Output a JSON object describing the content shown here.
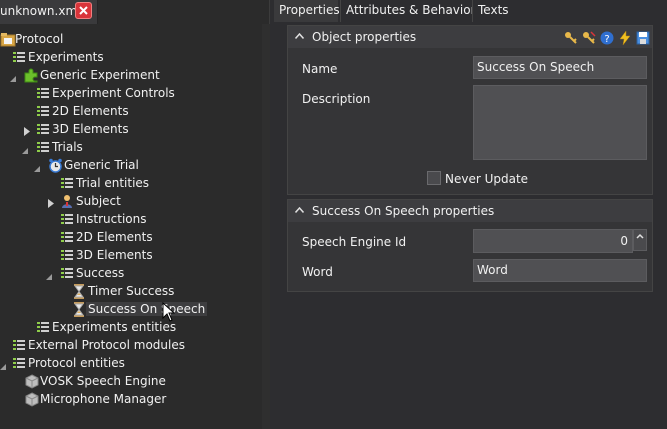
{
  "file_tab": {
    "label": "unknown.xml"
  },
  "tree": {
    "protocol": "Protocol",
    "experiments": "Experiments",
    "generic_experiment": "Generic Experiment",
    "experiment_controls": "Experiment Controls",
    "elements_2d_a": "2D Elements",
    "elements_3d_a": "3D Elements",
    "trials": "Trials",
    "generic_trial": "Generic Trial",
    "trial_entities": "Trial entities",
    "subject": "Subject",
    "instructions": "Instructions",
    "elements_2d_b": "2D Elements",
    "elements_3d_b": "3D Elements",
    "success": "Success",
    "timer_success": "Timer Success",
    "success_on_speech": "Success On Speech",
    "experiments_entities": "Experiments entities",
    "external_protocol_modules": "External Protocol modules",
    "protocol_entities": "Protocol entities",
    "vosk_speech_engine": "VOSK Speech Engine",
    "microphone_manager": "Microphone Manager"
  },
  "tabs": {
    "properties": "Properties",
    "attributes": "Attributes & Behaviors",
    "texts": "Texts"
  },
  "object_properties": {
    "title": "Object properties",
    "name_label": "Name",
    "name_value": "Success On Speech",
    "description_label": "Description",
    "description_value": "",
    "never_update_label": "Never Update"
  },
  "success_props": {
    "title": "Success On Speech properties",
    "speech_engine_label": "Speech Engine Id",
    "speech_engine_value": "0",
    "word_label": "Word",
    "word_value": "Word"
  },
  "colors": {
    "background": "#2d2d30",
    "tree_background": "#2b2b2b",
    "field_background": "#505053",
    "close_red": "#d9343a",
    "tree_list_green": "#8fce4a",
    "puzzle_green": "#6cc02b"
  }
}
